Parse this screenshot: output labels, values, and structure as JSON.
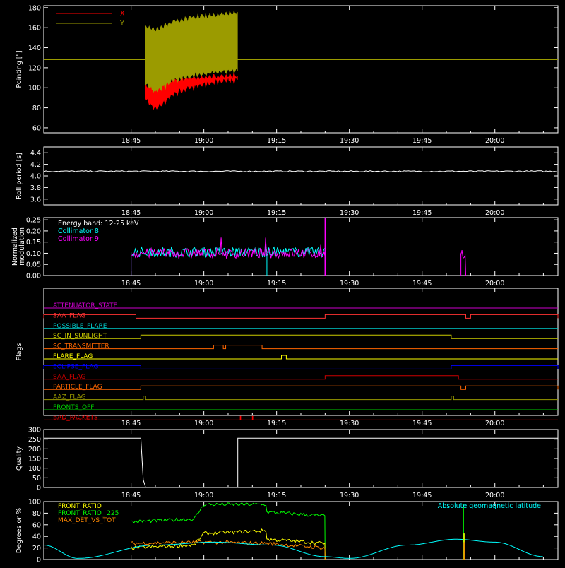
{
  "figure": {
    "time_ticks": [
      "18:45",
      "19:00",
      "19:15",
      "19:30",
      "19:45",
      "20:00"
    ]
  },
  "chart_data": [
    {
      "id": "pointing",
      "type": "line",
      "ylabel": "Pointing [\"]",
      "ylim": [
        55,
        182
      ],
      "yticks": [
        "60",
        "80",
        "100",
        "120",
        "140",
        "160",
        "180"
      ],
      "legend": [
        {
          "name": "X",
          "color": "#ff0000"
        },
        {
          "name": "Y",
          "color": "#9b9b00"
        }
      ],
      "reference_line": 128,
      "reference_color": "#9b9b00",
      "series": [
        {
          "name": "X",
          "color": "#ff0000",
          "time_range": [
            "18:48",
            "19:07"
          ],
          "envelope_low": [
            85,
            75,
            82,
            90,
            94,
            96,
            99,
            101,
            103,
            104,
            104
          ],
          "envelope_high": [
            105,
            108,
            110,
            112,
            113,
            113,
            114,
            115,
            115,
            115,
            116
          ]
        },
        {
          "name": "Y",
          "color": "#9b9b00",
          "time_range": [
            "18:48",
            "19:07"
          ],
          "envelope_low": [
            100,
            92,
            98,
            104,
            106,
            108,
            110,
            111,
            112,
            113,
            114
          ],
          "envelope_high": [
            165,
            162,
            165,
            170,
            172,
            174,
            175,
            176,
            177,
            178,
            178
          ]
        }
      ]
    },
    {
      "id": "roll",
      "type": "line",
      "ylabel": "Roll period [s]",
      "ylim": [
        3.5,
        4.5
      ],
      "yticks": [
        "3.6",
        "3.8",
        "4.0",
        "4.2",
        "4.4"
      ],
      "series": [
        {
          "name": "Roll period",
          "color": "#ffffff",
          "value": 4.08
        }
      ]
    },
    {
      "id": "modulation",
      "type": "line",
      "ylabel": [
        "Normalized",
        "modulation"
      ],
      "ylim": [
        0,
        0.26
      ],
      "yticks": [
        "0.00",
        "0.05",
        "0.10",
        "0.15",
        "0.20",
        "0.25"
      ],
      "legend": [
        {
          "name": "Energy band: 12-25 keV",
          "color": "#ffffff"
        },
        {
          "name": "Collimator 8",
          "color": "#00ffff"
        },
        {
          "name": "Collimator 9",
          "color": "#ff00ff"
        }
      ],
      "series": [
        {
          "name": "Collimator 8",
          "color": "#00ffff",
          "time_range": [
            "18:45",
            "19:25"
          ],
          "mean": 0.105
        },
        {
          "name": "Collimator 9",
          "color": "#ff00ff",
          "time_range": [
            "18:45",
            "19:25"
          ],
          "mean": 0.1
        },
        {
          "name": "late burst",
          "color": "#ff00ff",
          "time_range": [
            "19:53",
            "19:54"
          ],
          "mean": 0.1
        }
      ]
    },
    {
      "id": "flags",
      "type": "line",
      "ylabel": "Flags",
      "flags": [
        {
          "name": "ATTENUATOR_STATE",
          "color": "#cc00cc",
          "on": []
        },
        {
          "name": "SAA_FLAG",
          "color": "#ff3333",
          "on": [
            [
              "18:27",
              "18:46"
            ],
            [
              "19:25",
              "19:54"
            ],
            [
              "19:55",
              "20:13"
            ]
          ]
        },
        {
          "name": "POSSIBLE_FLARE",
          "color": "#00cccc",
          "on": []
        },
        {
          "name": "SC_IN_SUNLIGHT",
          "color": "#cccc00",
          "on": [
            [
              "18:47",
              "19:51"
            ]
          ]
        },
        {
          "name": "SC_TRANSMITTER",
          "color": "#ff6600",
          "on": [
            [
              "19:02",
              "19:04"
            ],
            [
              "19:04.5",
              "19:12"
            ]
          ]
        },
        {
          "name": "FLARE_FLAG",
          "color": "#ffff00",
          "on": [
            [
              "19:16",
              "19:17"
            ]
          ]
        },
        {
          "name": "ECLIPSE_FLAG",
          "color": "#0000ff",
          "on": [
            [
              "18:27",
              "18:47"
            ],
            [
              "19:51",
              "20:13"
            ]
          ]
        },
        {
          "name": "SAA_FLAG",
          "color": "#cc0000",
          "on": [
            [
              "19:25",
              "19:52.5"
            ]
          ]
        },
        {
          "name": "PARTICLE_FLAG",
          "color": "#ff6600",
          "on": [
            [
              "18:47",
              "19:53"
            ],
            [
              "19:54",
              "20:13"
            ]
          ]
        },
        {
          "name": "AAZ_FLAG",
          "color": "#999900",
          "on": [
            [
              "18:47.5",
              "18:48"
            ],
            [
              "19:51",
              "19:51.5"
            ]
          ]
        },
        {
          "name": "FRONTS_OFF",
          "color": "#00cc00",
          "on": []
        },
        {
          "name": "BAD_PACKETS",
          "color": "#ff0000",
          "on": [
            [
              "19:07.5",
              "19:07.6"
            ],
            [
              "19:10",
              "19:10.1"
            ]
          ]
        }
      ]
    },
    {
      "id": "quality",
      "type": "line",
      "ylabel": "Quality",
      "ylim": [
        0,
        300
      ],
      "yticks": [
        "0",
        "50",
        "100",
        "150",
        "200",
        "250",
        "300"
      ],
      "series": [
        {
          "name": "Quality",
          "color": "#ffffff",
          "points": [
            [
              "18:27",
              255
            ],
            [
              "18:47",
              255
            ],
            [
              "18:47.5",
              40
            ],
            [
              "18:48",
              0
            ],
            [
              "19:07",
              0
            ],
            [
              "19:07",
              255
            ],
            [
              "20:13",
              255
            ]
          ]
        }
      ]
    },
    {
      "id": "ratios",
      "type": "line",
      "ylabel": "Degrees or %",
      "ylim": [
        0,
        100
      ],
      "yticks": [
        "0",
        "20",
        "40",
        "60",
        "80",
        "100"
      ],
      "legend": [
        {
          "name": "FRONT_RATIO",
          "color": "#ffff00"
        },
        {
          "name": "FRONT_RATIO_ 225",
          "color": "#00ff00"
        },
        {
          "name": "MAX_DET_VS_TOT",
          "color": "#ff8800"
        }
      ],
      "annotation": {
        "text": "Absolute geomagnetic latitude",
        "color": "#00ffff"
      },
      "series": [
        {
          "name": "FRONT_RATIO_ 225",
          "color": "#00ff00",
          "points": [
            [
              "18:45",
              65
            ],
            [
              "18:58",
              70
            ],
            [
              "19:00",
              95
            ],
            [
              "19:13",
              95
            ],
            [
              "19:13",
              82
            ],
            [
              "19:25",
              75
            ]
          ]
        },
        {
          "name": "FRONT_RATIO",
          "color": "#ffff00",
          "points": [
            [
              "18:45",
              20
            ],
            [
              "18:58",
              25
            ],
            [
              "19:00",
              45
            ],
            [
              "19:13",
              50
            ],
            [
              "19:13",
              35
            ],
            [
              "19:25",
              28
            ]
          ]
        },
        {
          "name": "MAX_DET_VS_TOT",
          "color": "#ff8800",
          "points": [
            [
              "18:45",
              28
            ],
            [
              "19:00",
              30
            ],
            [
              "19:13",
              28
            ],
            [
              "19:25",
              20
            ]
          ]
        },
        {
          "name": "Absolute geomagnetic latitude",
          "color": "#00ffff",
          "points": [
            [
              "18:27",
              25
            ],
            [
              "18:34",
              2
            ],
            [
              "18:50",
              25
            ],
            [
              "19:02",
              30
            ],
            [
              "19:14",
              25
            ],
            [
              "19:25",
              5
            ],
            [
              "19:30",
              2
            ],
            [
              "19:42",
              25
            ],
            [
              "19:52",
              35
            ],
            [
              "20:00",
              30
            ],
            [
              "20:10",
              5
            ]
          ]
        }
      ]
    }
  ]
}
